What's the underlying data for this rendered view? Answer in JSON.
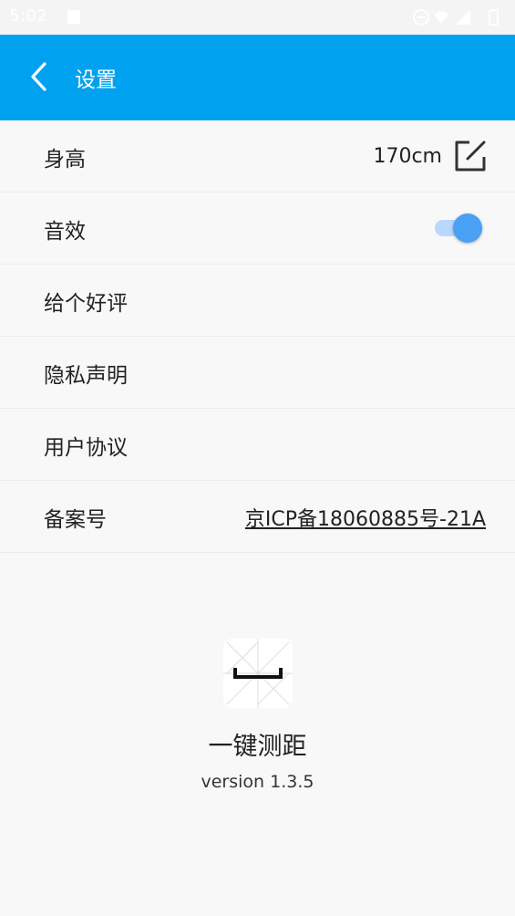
{
  "status_bar": {
    "time": "5:02"
  },
  "app_bar": {
    "title": "设置"
  },
  "settings": {
    "height_label": "身高",
    "height_value": "170cm",
    "sound_label": "音效",
    "sound_enabled": true,
    "rate_label": "给个好评",
    "privacy_label": "隐私声明",
    "agreement_label": "用户协议",
    "beian_label": "备案号",
    "beian_value": "京ICP备18060885号-21A"
  },
  "about": {
    "app_name": "一键测距",
    "version": "version 1.3.5"
  },
  "colors": {
    "primary": "#00a2ef",
    "toggle_thumb": "#4aa0f3",
    "toggle_track": "#b9d8fb",
    "background": "#f8f8f8"
  }
}
